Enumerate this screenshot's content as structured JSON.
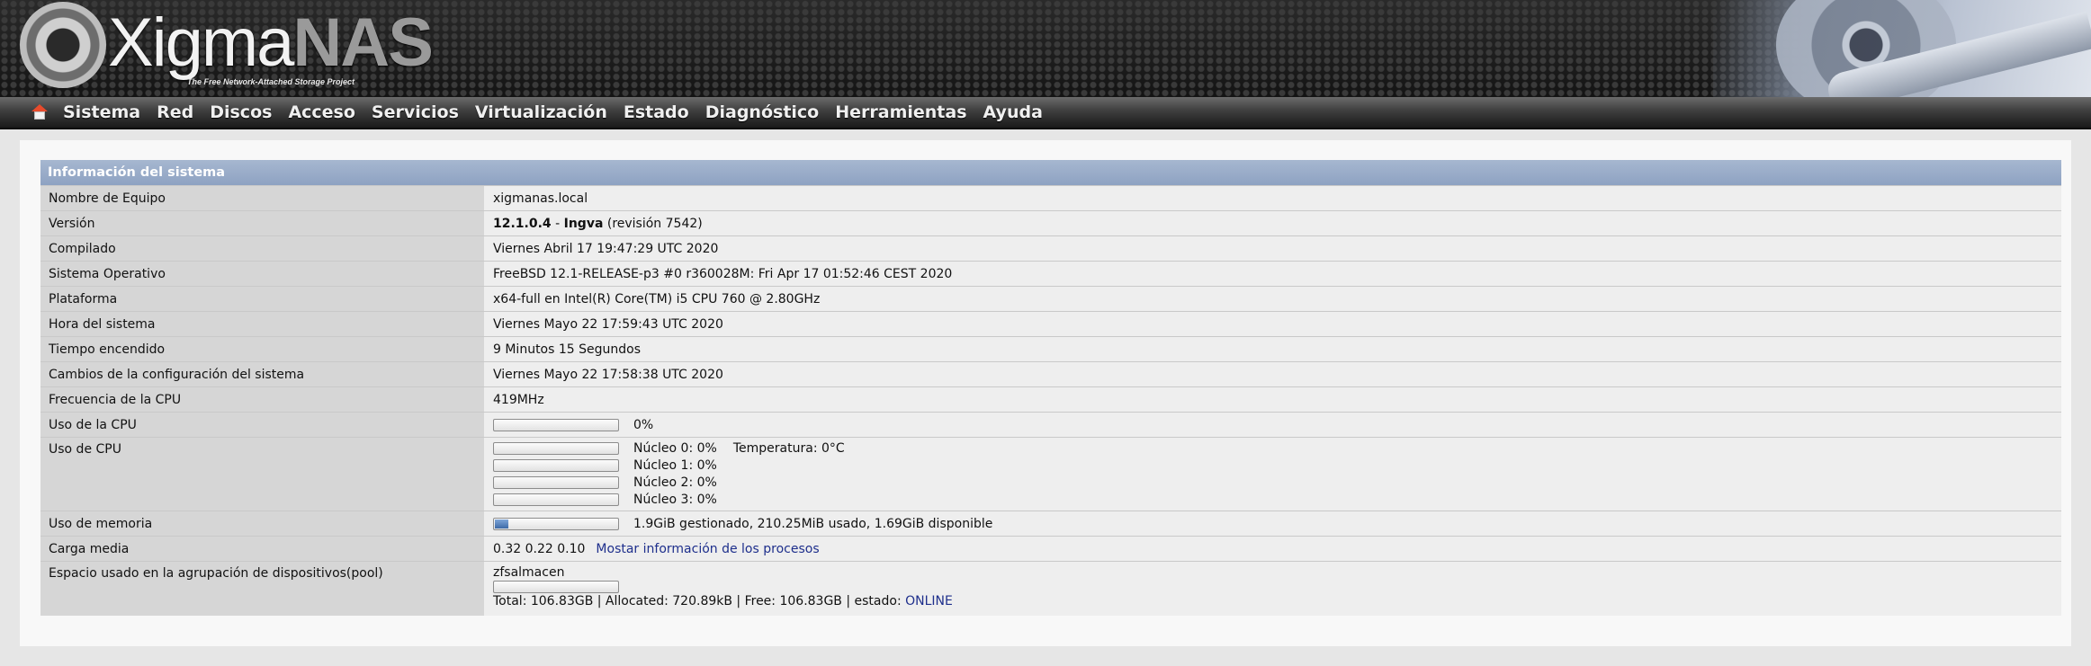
{
  "brand": {
    "name_part1": "Xigma",
    "name_part2": "NAS",
    "tagline": "The Free Network-Attached Storage Project"
  },
  "nav": {
    "items": [
      "Sistema",
      "Red",
      "Discos",
      "Acceso",
      "Servicios",
      "Virtualización",
      "Estado",
      "Diagnóstico",
      "Herramientas",
      "Ayuda"
    ]
  },
  "panel": {
    "title": "Información del sistema",
    "hostname": {
      "label": "Nombre de Equipo",
      "value": "xigmanas.local"
    },
    "version": {
      "label": "Versión",
      "number": "12.1.0.4",
      "sep": " - ",
      "codename": "Ingva",
      "revision": " (revisión 7542)"
    },
    "compiled": {
      "label": "Compilado",
      "value": "Viernes Abril 17 19:47:29 UTC 2020"
    },
    "os": {
      "label": "Sistema Operativo",
      "value": "FreeBSD 12.1-RELEASE-p3 #0 r360028M: Fri Apr 17 01:52:46 CEST 2020"
    },
    "platform": {
      "label": "Plataforma",
      "value": "x64-full en Intel(R) Core(TM) i5 CPU 760 @ 2.80GHz"
    },
    "system_time": {
      "label": "Hora del sistema",
      "value": "Viernes Mayo 22 17:59:43 UTC 2020"
    },
    "uptime": {
      "label": "Tiempo encendido",
      "value": "9 Minutos 15 Segundos"
    },
    "config_changes": {
      "label": "Cambios de la configuración del sistema",
      "value": "Viernes Mayo 22 17:58:38 UTC 2020"
    },
    "cpu_freq": {
      "label": "Frecuencia de la CPU",
      "value": "419MHz"
    },
    "cpu_usage": {
      "label": "Uso de la CPU",
      "value": "0%",
      "percent": 0
    },
    "cpu_cores": {
      "label": "Uso de CPU",
      "temperature": "Temperatura: 0°C",
      "cores": [
        {
          "text": "Núcleo 0: 0%",
          "percent": 0
        },
        {
          "text": "Núcleo 1: 0%",
          "percent": 0
        },
        {
          "text": "Núcleo 2: 0%",
          "percent": 0
        },
        {
          "text": "Núcleo 3: 0%",
          "percent": 0
        }
      ]
    },
    "memory": {
      "label": "Uso de memoria",
      "value": "1.9GiB gestionado, 210.25MiB usado, 1.69GiB disponible",
      "percent": 11
    },
    "load": {
      "label": "Carga media",
      "value": "0.32 0.22 0.10",
      "link": "Mostar información de los procesos"
    },
    "pool": {
      "label": "Espacio usado en la agrupación de dispositivos(pool)",
      "name": "zfsalmacen",
      "percent": 0,
      "summary": "Total: 106.83GB | Allocated: 720.89kB | Free: 106.83GB | estado: ",
      "status": "ONLINE"
    }
  },
  "colors": {
    "panel_header": "#94a7c6",
    "link": "#1e2f8c",
    "bar_fill": "#4a78b5"
  }
}
